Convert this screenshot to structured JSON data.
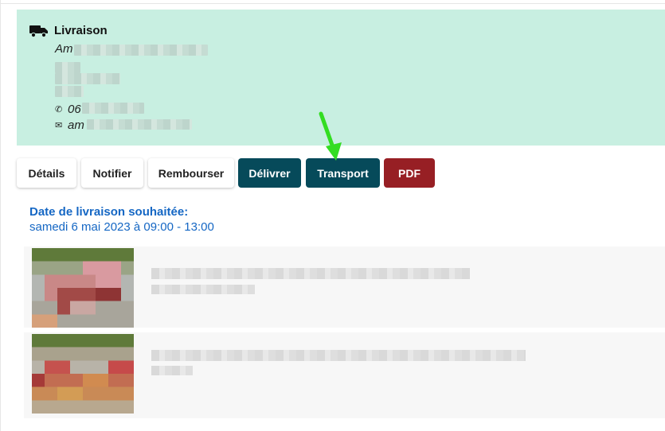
{
  "delivery": {
    "title": "Livraison",
    "name_prefix": "Am",
    "phone_prefix": "06",
    "email_prefix": "am"
  },
  "actions": {
    "details": "Détails",
    "notify": "Notifier",
    "refund": "Rembourser",
    "deliver": "Délivrer",
    "transport": "Transport",
    "pdf": "PDF"
  },
  "delivery_date": {
    "label": "Date de livraison souhaitée:",
    "value": "samedi 6 mai 2023 à 09:00 - 13:00"
  },
  "colors": {
    "card_bg": "#c8efe1",
    "dark_button": "#064a5a",
    "pdf_button": "#971f24",
    "link_blue": "#1567c4",
    "annotation_arrow": "#33dd22"
  },
  "icons": {
    "truck": "truck-icon",
    "phone": "phone-icon",
    "mail": "mail-icon",
    "annotation": "green-arrow-icon"
  }
}
